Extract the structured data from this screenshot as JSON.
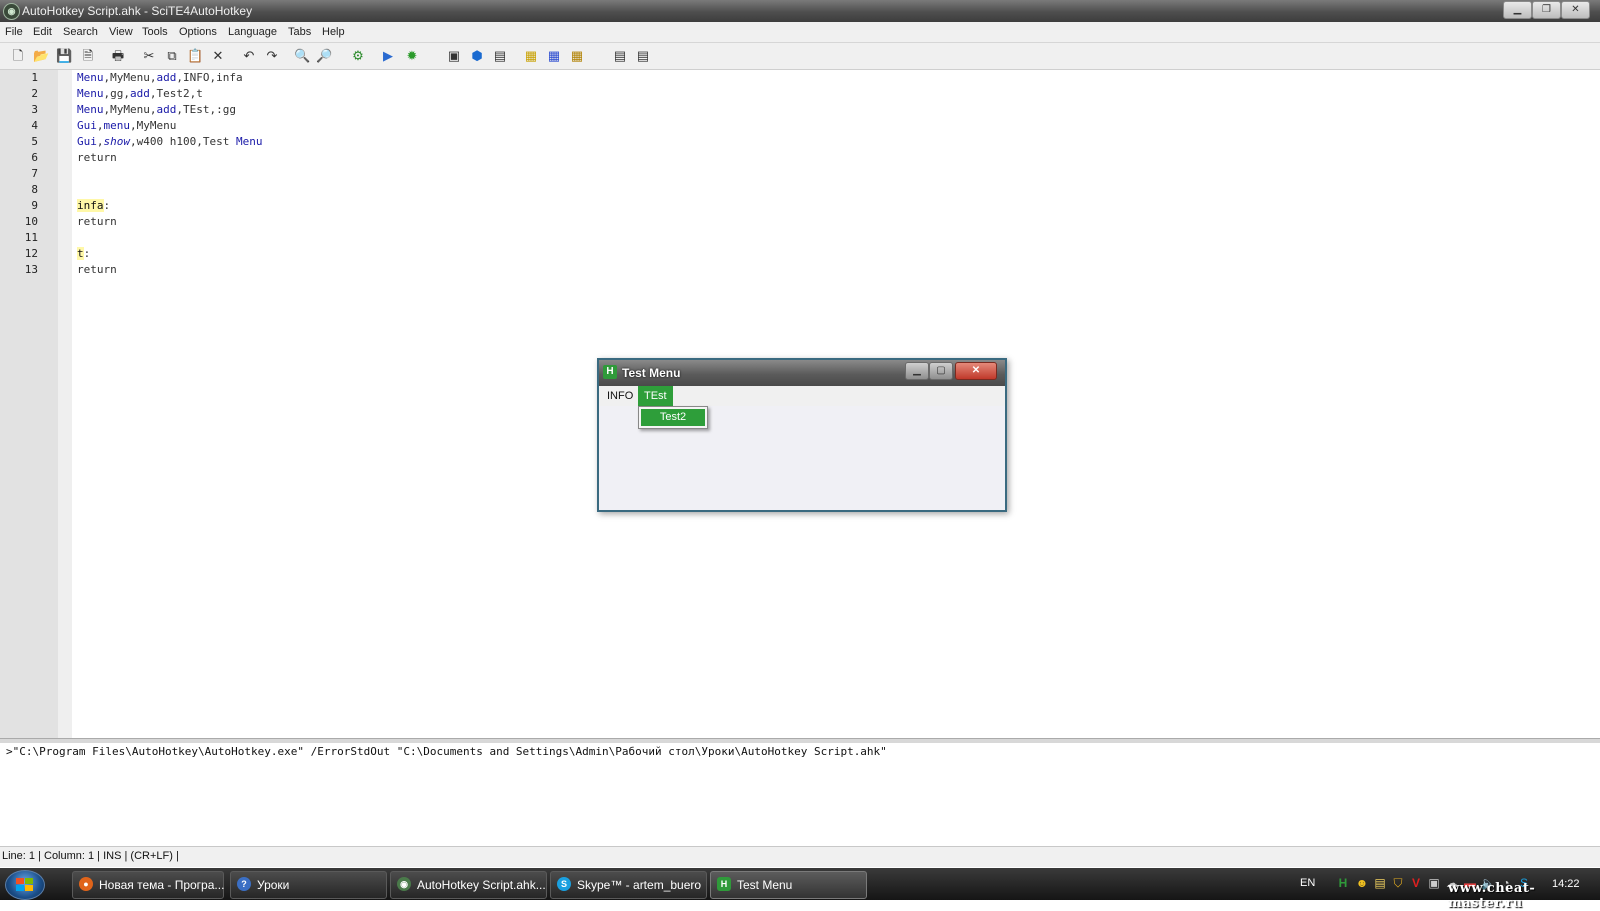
{
  "window": {
    "title": "AutoHotkey Script.ahk - SciTE4AutoHotkey",
    "app_icon": "scite-icon",
    "controls": {
      "minimize": "minimize-icon",
      "maximize": "maximize-icon",
      "close": "close-icon"
    }
  },
  "menubar": {
    "items": [
      "File",
      "Edit",
      "Search",
      "View",
      "Tools",
      "Options",
      "Language",
      "Tabs",
      "Help"
    ]
  },
  "toolbar": {
    "icons": [
      "new-file-icon",
      "open-icon",
      "save-icon",
      "close-file-icon",
      "print-icon",
      "cut-icon",
      "copy-icon",
      "paste-icon",
      "delete-icon",
      "undo-icon",
      "redo-icon",
      "find-icon",
      "find-small-icon",
      "compile-icon",
      "run-icon",
      "debug-icon",
      "properties-icon",
      "package-icon",
      "window-spy-icon",
      "notes-icon",
      "script-icon",
      "function-icon",
      "help-icon",
      "reference-icon"
    ]
  },
  "editor": {
    "line_numbers": [
      "1",
      "2",
      "3",
      "4",
      "5",
      "6",
      "7",
      "8",
      "9",
      "10",
      "11",
      "12",
      "13"
    ],
    "lines": [
      [
        {
          "t": "Menu",
          "c": "kw"
        },
        {
          "t": ",MyMenu,",
          "c": ""
        },
        {
          "t": "add",
          "c": "kw"
        },
        {
          "t": ",INFO,infa",
          "c": ""
        }
      ],
      [
        {
          "t": "Menu",
          "c": "kw"
        },
        {
          "t": ",gg,",
          "c": ""
        },
        {
          "t": "add",
          "c": "kw"
        },
        {
          "t": ",Test2,t",
          "c": ""
        }
      ],
      [
        {
          "t": "Menu",
          "c": "kw"
        },
        {
          "t": ",MyMenu,",
          "c": ""
        },
        {
          "t": "add",
          "c": "kw"
        },
        {
          "t": ",TEst,:gg",
          "c": ""
        }
      ],
      [
        {
          "t": "Gui",
          "c": "kw"
        },
        {
          "t": ",",
          "c": ""
        },
        {
          "t": "menu",
          "c": "kw"
        },
        {
          "t": ",MyMenu",
          "c": ""
        }
      ],
      [
        {
          "t": "Gui",
          "c": "kw"
        },
        {
          "t": ",",
          "c": ""
        },
        {
          "t": "show",
          "c": "it"
        },
        {
          "t": ",w400 h100,Test ",
          "c": ""
        },
        {
          "t": "Menu",
          "c": "kw"
        }
      ],
      [
        {
          "t": "return",
          "c": ""
        }
      ],
      [],
      [],
      [
        {
          "t": "infa",
          "c": "lbl"
        },
        {
          "t": ":",
          "c": ""
        }
      ],
      [
        {
          "t": "return",
          "c": ""
        }
      ],
      [],
      [
        {
          "t": "t",
          "c": "lbl"
        },
        {
          "t": ":",
          "c": ""
        }
      ],
      [
        {
          "t": "return",
          "c": ""
        }
      ]
    ]
  },
  "output": {
    "text": ">\"C:\\Program Files\\AutoHotkey\\AutoHotkey.exe\" /ErrorStdOut \"C:\\Documents and Settings\\Admin\\Рабочий стол\\Уроки\\AutoHotkey Script.ahk\""
  },
  "statusbar": {
    "text": "Line: 1 | Column: 1 | INS | (CR+LF) |"
  },
  "test_window": {
    "title": "Test Menu",
    "menu_items": [
      "INFO",
      "TEst"
    ],
    "active_menu": "TEst",
    "submenu_items": [
      "Test2"
    ]
  },
  "taskbar": {
    "tasks": [
      {
        "label": "Новая тема - Програ...",
        "icon": "firefox-icon",
        "color": "#e0641a"
      },
      {
        "label": "Уроки",
        "icon": "help-folder-icon",
        "color": "#3b6fc4"
      },
      {
        "label": "AutoHotkey Script.ahk...",
        "icon": "scite-icon",
        "color": "#4a7a4a"
      },
      {
        "label": "Skype™ - artem_buero",
        "icon": "skype-icon",
        "color": "#1aa0e0"
      },
      {
        "label": "Test Menu",
        "icon": "ahk-icon",
        "color": "#2f9a3a"
      }
    ],
    "language": "EN",
    "tray_icons": [
      "ahk-tray-icon",
      "smiley-tray-icon",
      "note-tray-icon",
      "shield-tray-icon",
      "antivirus-tray-icon",
      "network-tray-icon",
      "cloud-tray-icon",
      "battery-tray-icon",
      "volume-tray-icon",
      "update-tray-icon",
      "skype-tray-icon"
    ],
    "clock": "14:22",
    "watermark": "www.cheat-master.ru"
  }
}
